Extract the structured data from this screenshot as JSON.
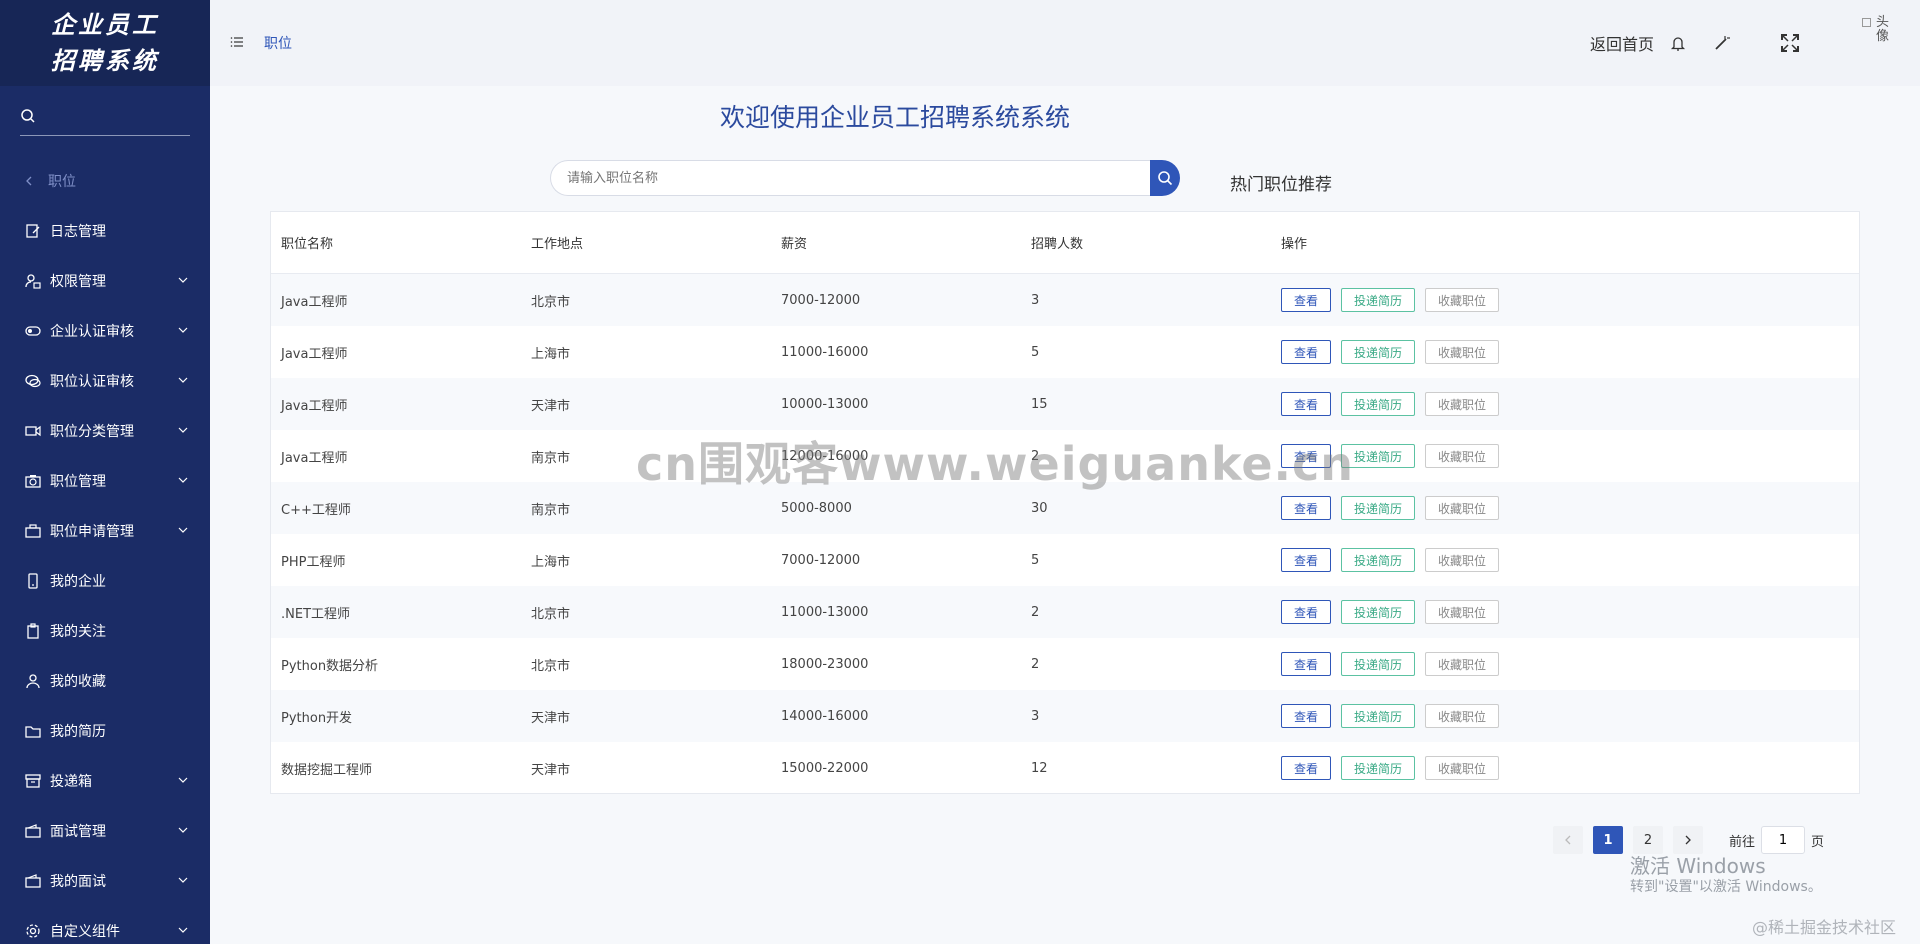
{
  "sidebar": {
    "logo_line1": "企业员工",
    "logo_line2": "招聘系统",
    "items": [
      {
        "label": "职位",
        "icon": "chevron-left-icon"
      },
      {
        "label": "日志管理",
        "icon": "edit-icon"
      },
      {
        "label": "权限管理",
        "icon": "user-lock-icon"
      },
      {
        "label": "企业认证审核",
        "icon": "toggle-icon"
      },
      {
        "label": "职位认证审核",
        "icon": "chat-icon"
      },
      {
        "label": "职位分类管理",
        "icon": "video-icon"
      },
      {
        "label": "职位管理",
        "icon": "camera-icon"
      },
      {
        "label": "职位申请管理",
        "icon": "briefcase-icon"
      },
      {
        "label": "我的企业",
        "icon": "phone-icon"
      },
      {
        "label": "我的关注",
        "icon": "clipboard-icon"
      },
      {
        "label": "我的收藏",
        "icon": "user-icon"
      },
      {
        "label": "我的简历",
        "icon": "folder-icon"
      },
      {
        "label": "投递箱",
        "icon": "box-icon"
      },
      {
        "label": "面试管理",
        "icon": "wallet-icon"
      },
      {
        "label": "我的面试",
        "icon": "wallet-icon"
      },
      {
        "label": "自定义组件",
        "icon": "settings-icon"
      }
    ]
  },
  "header": {
    "breadcrumb": "职位",
    "back_home": "返回首页",
    "avatar_alt_1": "头",
    "avatar_alt_2": "像"
  },
  "main": {
    "title": "欢迎使用企业员工招聘系统系统",
    "search_placeholder": "请输入职位名称",
    "hot_label": "热门职位推荐"
  },
  "table": {
    "headers": [
      "职位名称",
      "工作地点",
      "薪资",
      "招聘人数",
      "操作"
    ],
    "rows": [
      {
        "name": "Java工程师",
        "location": "北京市",
        "salary": "7000-12000",
        "count": "3"
      },
      {
        "name": "Java工程师",
        "location": "上海市",
        "salary": "11000-16000",
        "count": "5"
      },
      {
        "name": "Java工程师",
        "location": "天津市",
        "salary": "10000-13000",
        "count": "15"
      },
      {
        "name": "Java工程师",
        "location": "南京市",
        "salary": "12000-16000",
        "count": "2"
      },
      {
        "name": "C++工程师",
        "location": "南京市",
        "salary": "5000-8000",
        "count": "30"
      },
      {
        "name": "PHP工程师",
        "location": "上海市",
        "salary": "7000-12000",
        "count": "5"
      },
      {
        "name": ".NET工程师",
        "location": "北京市",
        "salary": "11000-13000",
        "count": "2"
      },
      {
        "name": "Python数据分析",
        "location": "北京市",
        "salary": "18000-23000",
        "count": "2"
      },
      {
        "name": "Python开发",
        "location": "天津市",
        "salary": "14000-16000",
        "count": "3"
      },
      {
        "name": "数据挖掘工程师",
        "location": "天津市",
        "salary": "15000-22000",
        "count": "12"
      }
    ],
    "actions": {
      "view": "查看",
      "apply": "投递简历",
      "favorite": "收藏职位"
    }
  },
  "pagination": {
    "pages": [
      "1",
      "2"
    ],
    "current": "1",
    "goto_label": "前往",
    "goto_value": "1",
    "page_suffix": "页"
  },
  "watermarks": {
    "center": "cn围观客www.weiguanke.cn",
    "windows_1": "激活 Windows",
    "windows_2": "转到\"设置\"以激活 Windows。",
    "juejin": "@稀土掘金技术社区"
  },
  "colors": {
    "sidebar_bg": "#1b2c66",
    "accent": "#2f56b8",
    "apply_green": "#3aaa86"
  }
}
